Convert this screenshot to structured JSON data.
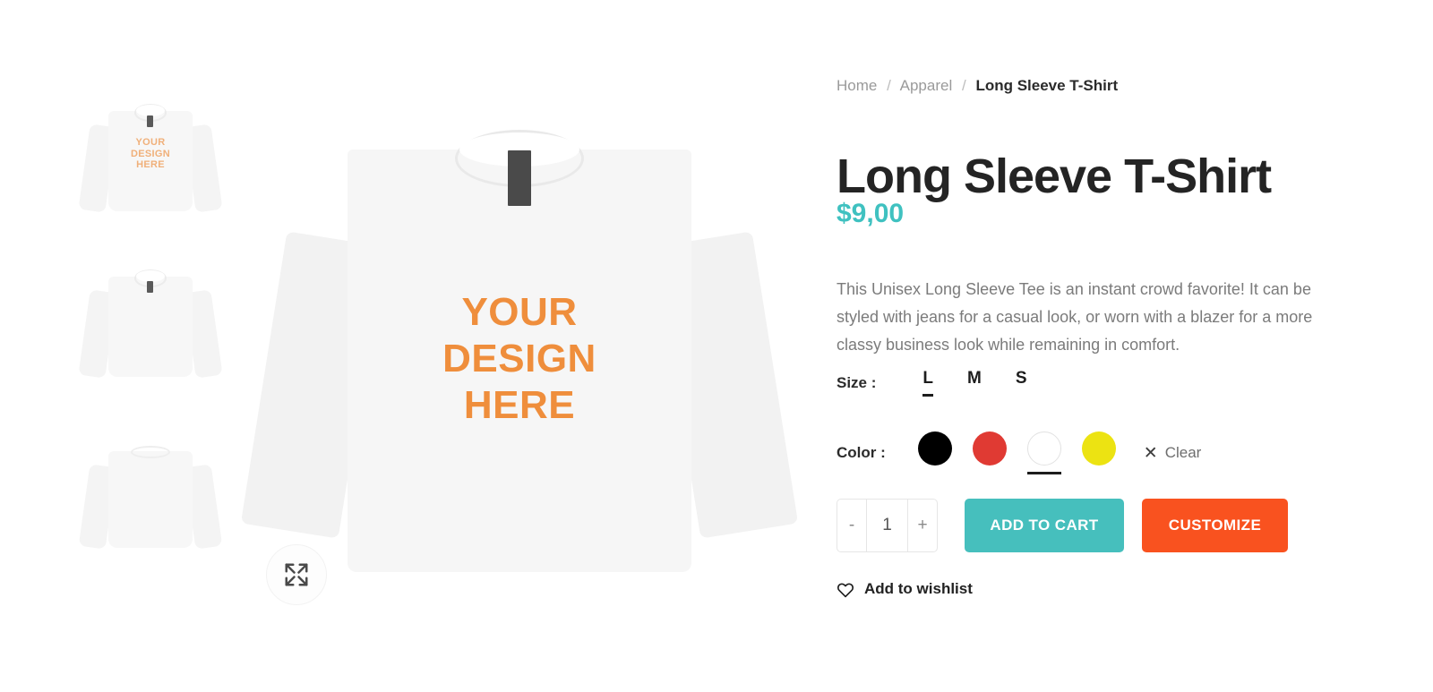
{
  "breadcrumb": {
    "items": [
      "Home",
      "Apparel",
      "Long Sleeve T-Shirt"
    ],
    "separator": "/"
  },
  "product": {
    "title": "Long Sleeve T-Shirt",
    "price": "$9,00",
    "description": "This Unisex Long Sleeve Tee is an instant crowd favorite! It can be styled with jeans for a casual look, or worn with a blazer for a more classy business look while remaining in comfort."
  },
  "gallery": {
    "print_lines": [
      "YOUR",
      "DESIGN",
      "HERE"
    ],
    "thumbnails": [
      {
        "name": "front-with-print",
        "has_print": true
      },
      {
        "name": "front-blank",
        "has_print": false
      },
      {
        "name": "back-view",
        "has_print": false
      }
    ],
    "zoom_icon": "expand-arrows-icon"
  },
  "options": {
    "size": {
      "label": "Size :",
      "values": [
        "L",
        "M",
        "S"
      ],
      "selected": "L"
    },
    "color": {
      "label": "Color :",
      "swatches": [
        {
          "name": "black",
          "hex": "#000000"
        },
        {
          "name": "red",
          "hex": "#e03a33"
        },
        {
          "name": "white",
          "hex": "#ffffff"
        },
        {
          "name": "yellow",
          "hex": "#ece312"
        }
      ],
      "selected": "white",
      "clear_label": "Clear",
      "clear_icon": "close-x-icon"
    }
  },
  "purchase": {
    "quantity": "1",
    "decrement_label": "-",
    "increment_label": "+",
    "add_to_cart_label": "ADD TO CART",
    "customize_label": "CUSTOMIZE"
  },
  "wishlist": {
    "label": "Add to wishlist",
    "icon": "heart-outline-icon"
  },
  "colors": {
    "price_teal": "#3fc1c0",
    "cart_teal": "#46bfbd",
    "customize_orange": "#f9521f",
    "print_orange": "#ef8e3c"
  }
}
